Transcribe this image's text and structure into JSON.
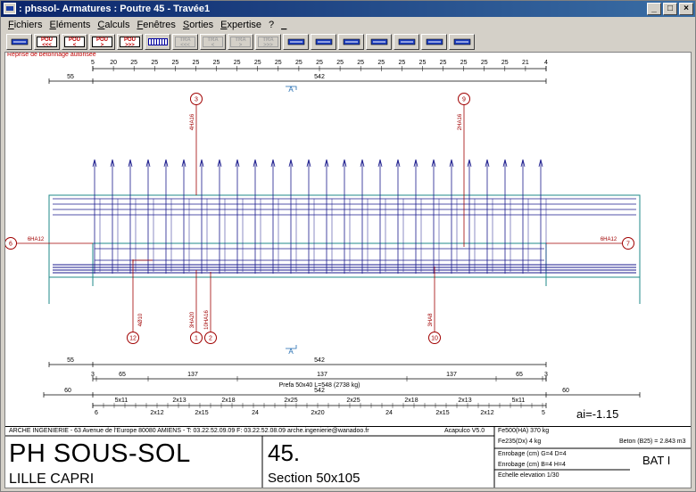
{
  "window": {
    "title": ": phssol- Armatures : Poutre 45 - Travée1",
    "buttons": [
      "_",
      "□",
      "×"
    ]
  },
  "menu": [
    "Fichiers",
    "Eléments",
    "Calculs",
    "Fenêtres",
    "Sorties",
    "Expertise",
    "?",
    "_"
  ],
  "toolbar": {
    "buttons": [
      {
        "name": "select-tool-button",
        "kind": "glyph"
      },
      {
        "name": "pou-first-button",
        "label": "POU\n<<<",
        "disabled": false
      },
      {
        "name": "pou-prev-button",
        "label": "POU\n<",
        "disabled": false
      },
      {
        "name": "pou-next-button",
        "label": "POU\n>",
        "disabled": false
      },
      {
        "name": "pou-last-button",
        "label": "POU\n>>>",
        "disabled": false
      },
      {
        "name": "span-view-button",
        "kind": "bar"
      },
      {
        "name": "tra-first-button",
        "label": "TRA\n<<<",
        "disabled": true
      },
      {
        "name": "tra-prev-button",
        "label": "TRA\n<",
        "disabled": true
      },
      {
        "name": "tra-next-button",
        "label": "TRA\n>",
        "disabled": true
      },
      {
        "name": "tra-last-button",
        "label": "TRA\n>>>",
        "disabled": true
      },
      {
        "name": "section-button",
        "kind": "glyph"
      },
      {
        "name": "table-button",
        "kind": "glyph"
      },
      {
        "name": "slab-button",
        "kind": "glyph"
      },
      {
        "name": "bars-button",
        "kind": "glyph"
      },
      {
        "name": "transfer-button",
        "kind": "glyph"
      },
      {
        "name": "support-button",
        "kind": "glyph"
      },
      {
        "name": "beam-button",
        "kind": "glyph"
      }
    ]
  },
  "drawing": {
    "reprise_note": "Reprise de bétonnage autorisée",
    "top_spacing": {
      "ticks": [
        "5",
        "20",
        "25",
        "25",
        "25",
        "25",
        "25",
        "25",
        "25",
        "25",
        "25",
        "25",
        "25",
        "25",
        "25",
        "25",
        "25",
        "25",
        "25",
        "25",
        "25",
        "21",
        "4"
      ],
      "left": "55",
      "total": "542"
    },
    "markers": [
      {
        "num": "3",
        "label": "4HA16"
      },
      {
        "num": "9",
        "label": "2HA16"
      },
      {
        "num": "6",
        "label": "6HA12"
      },
      {
        "num": "7",
        "label": "6HA12"
      },
      {
        "num": "12",
        "label": "4Ø10"
      },
      {
        "num": "1",
        "label": "3HA20"
      },
      {
        "num": "2",
        "label": "10HA16"
      },
      {
        "num": "10",
        "label": "3HA8"
      }
    ],
    "section_marks": {
      "top": "A",
      "bottom": "A"
    },
    "bottom_dims": {
      "row1": {
        "left": "55",
        "total": "542"
      },
      "row2": [
        "3",
        "65",
        "137",
        "137",
        "137",
        "65",
        "3"
      ],
      "prefa": "Prefa 50x40  L=548 (2738 kg)",
      "row3": {
        "left": "60",
        "total": "542",
        "right": "60"
      },
      "stirrups_top": [
        "5x11",
        "2x13",
        "2x18",
        "2x25",
        "2x25",
        "2x18",
        "2x13",
        "5x11"
      ],
      "stirrups_bottom": [
        "6",
        "2x12",
        "2x15",
        "24",
        "2x20",
        "24",
        "2x15",
        "2x12",
        "5"
      ]
    },
    "ai_value": "ai=-1.15"
  },
  "cartouche": {
    "org": "ARCHE INGENIERIE - 63 Avenue de l'Europe 80080 AMIENS - T: 03.22.52.09.09 F: 03.22.52.08.09 arche.ingenierie@wanadoo.fr",
    "version": "Acapulco V5.0",
    "project": "PH SOUS-SOL",
    "location": "LILLE CAPRI",
    "number": "45.",
    "section": "Section 50x105",
    "fe500": "Fe500(HA) 370 kg",
    "fe235": "Fe235(Dx) 4 kg",
    "beton": "Beton (B25) = 2.843 m3",
    "enrobage1": "Enrobage (cm) G=4 D=4",
    "enrobage2": "Enrobage (cm) B=4 H=4",
    "echelle": "Echelle elevation 1/30",
    "bat": "BAT I"
  }
}
